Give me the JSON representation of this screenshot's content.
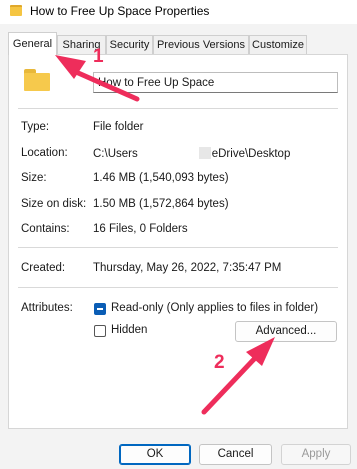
{
  "window": {
    "title": "How to Free Up Space Properties"
  },
  "tabs": [
    {
      "label": "General"
    },
    {
      "label": "Sharing"
    },
    {
      "label": "Security"
    },
    {
      "label": "Previous Versions"
    },
    {
      "label": "Customize"
    }
  ],
  "general": {
    "name_value": "How to Free Up Space",
    "type_label": "Type:",
    "type_value": "File folder",
    "location_label": "Location:",
    "location_prefix": "C:\\Users",
    "location_suffix": "eDrive\\Desktop",
    "size_label": "Size:",
    "size_value": "1.46 MB (1,540,093 bytes)",
    "size_on_disk_label": "Size on disk:",
    "size_on_disk_value": "1.50 MB (1,572,864 bytes)",
    "contains_label": "Contains:",
    "contains_value": "16 Files, 0 Folders",
    "created_label": "Created:",
    "created_value": "Thursday, May 26, 2022, 7:35:47 PM",
    "attributes_label": "Attributes:",
    "readonly_label": "Read-only (Only applies to files in folder)",
    "hidden_label": "Hidden",
    "advanced_label": "Advanced..."
  },
  "footer": {
    "ok_label": "OK",
    "cancel_label": "Cancel",
    "apply_label": "Apply"
  },
  "annotations": [
    {
      "number": "1"
    },
    {
      "number": "2"
    }
  ],
  "colors": {
    "accent": "#0a5db5",
    "annotation": "#ee2d5b",
    "folder": "#f6c94c"
  }
}
